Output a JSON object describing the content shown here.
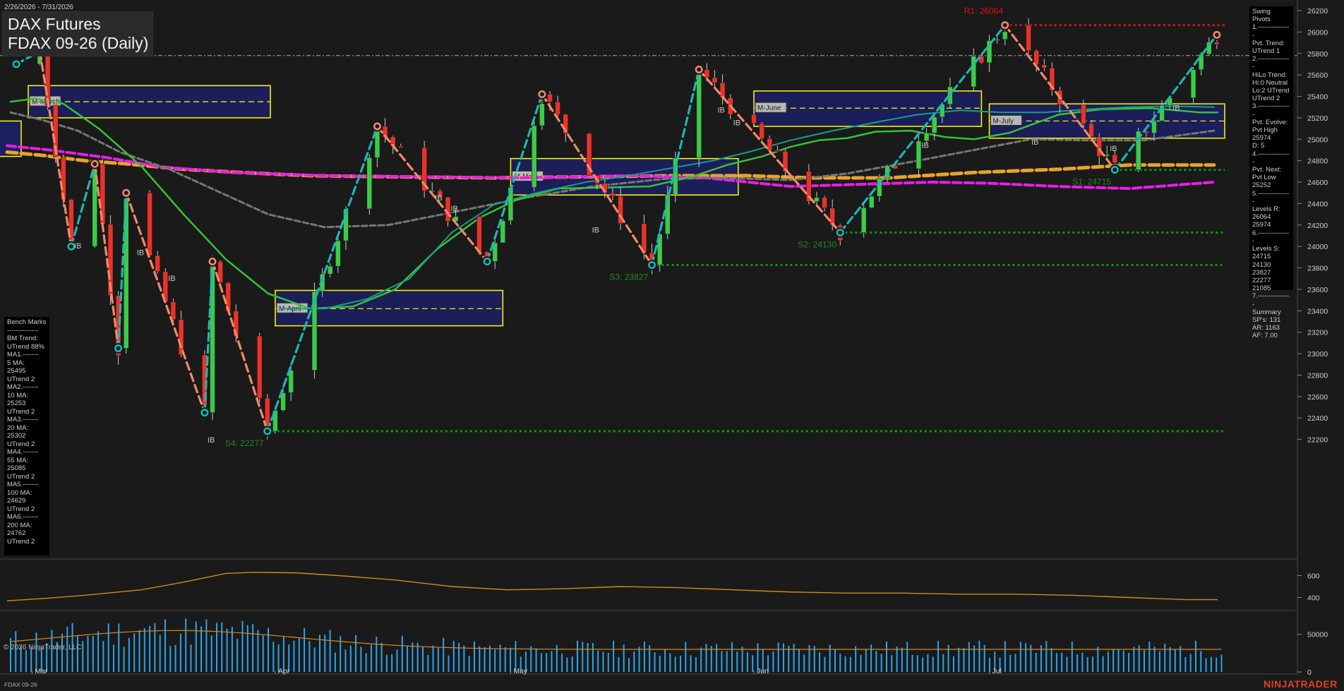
{
  "header": {
    "date_range": "2/26/2026 - 7/31/2026",
    "instrument": "DAX Futures",
    "contract": "FDAX 09-26 (Daily)"
  },
  "pivot_panel": {
    "lines": [
      "Swing Pivots",
      "1.---------------",
      "Pvt. Trend:",
      "UTrend 1",
      "2.---------------",
      "HiLo Trend:",
      "Hi:0 Neutral",
      "Lo:2 UTrend",
      "UTrend 2",
      "3.---------------",
      "Pvt. Evolve:",
      "Pvt High",
      "25974",
      "D: 5",
      "4.---------------",
      "Pvt. Next:",
      "Pvt Low",
      "25252",
      "5.---------------",
      "Levels R:",
      "26064",
      "25974",
      "6.---------------",
      "Levels S:",
      "24715",
      "24130",
      "23827",
      "22277",
      "21085",
      "7.---------------",
      "Summary",
      "SP's: 131",
      "AR: 1163",
      "AF: 7.00"
    ]
  },
  "bench_panel": {
    "lines": [
      "Bench Marks",
      "--------------",
      "BM Trend:",
      "UTrend 88%",
      "MA1.-------",
      "5 MA:",
      "25495",
      "UTrend 2",
      "MA2.-------",
      "10 MA:",
      "25253",
      "UTrend 2",
      "MA3.-------",
      "20 MA:",
      "25302",
      "UTrend 2",
      "MA4.-------",
      "55 MA:",
      "25085",
      "UTrend 2",
      "MA5.-------",
      "100 MA:",
      "24629",
      "UTrend 2",
      "MA6.-------",
      "200 MA:",
      "24762",
      "UTrend 2"
    ]
  },
  "footer": {
    "copyright": "© 2026 NinjaTrader, LLC",
    "symbol": "FDAX 09-26",
    "brand": "NINJATRADER"
  },
  "colors": {
    "background": "#1a1a1a",
    "up_candle": "#3ec94a",
    "down_candle": "#e8332b",
    "swing_up": "#1fb5b5",
    "swing_down": "#f08a6a",
    "resistance": "#e01010",
    "support": "#0a9a0a",
    "ma_green": "#36c136",
    "ma_teal": "#1a9c8f",
    "ma_gray": "#777777",
    "ma_orange": "#e8a32c",
    "ma_magenta": "#e81ee8",
    "monthly_box_fill": "#1c1f60",
    "monthly_box_border": "#ffff00",
    "volume": "#2aa4ee",
    "oscillator": "#d4891a"
  },
  "chart_data": {
    "type": "candlestick",
    "title": "FDAX 09-26 (Daily)",
    "x_range": [
      "2026-02-26",
      "2026-07-31"
    ],
    "x_ticks": [
      "Mar",
      "Apr",
      "May",
      "Jun",
      "Jul"
    ],
    "y_range": [
      22000,
      26200
    ],
    "y_ticks": [
      22200,
      22400,
      22600,
      22800,
      23000,
      23200,
      23400,
      23600,
      23800,
      24000,
      24200,
      24400,
      24600,
      24800,
      25000,
      25200,
      25400,
      25600,
      25800,
      26000,
      26200
    ],
    "swing_points": [
      {
        "date": "2026-02-27",
        "price": 25700,
        "type": "low"
      },
      {
        "date": "2026-03-02",
        "price": 25820,
        "type": "high"
      },
      {
        "date": "2026-03-06",
        "price": 24000,
        "type": "low"
      },
      {
        "date": "2026-03-09",
        "price": 24770,
        "type": "high"
      },
      {
        "date": "2026-03-12",
        "price": 23050,
        "type": "low"
      },
      {
        "date": "2026-03-13",
        "price": 24500,
        "type": "high"
      },
      {
        "date": "2026-03-23",
        "price": 22450,
        "type": "low"
      },
      {
        "date": "2026-03-24",
        "price": 23860,
        "type": "high"
      },
      {
        "date": "2026-03-31",
        "price": 22277,
        "type": "low"
      },
      {
        "date": "2026-04-14",
        "price": 25120,
        "type": "high"
      },
      {
        "date": "2026-04-28",
        "price": 23860,
        "type": "low"
      },
      {
        "date": "2026-05-05",
        "price": 25420,
        "type": "high"
      },
      {
        "date": "2026-05-19",
        "price": 23827,
        "type": "low"
      },
      {
        "date": "2026-05-25",
        "price": 25650,
        "type": "high"
      },
      {
        "date": "2026-06-12",
        "price": 24130,
        "type": "low"
      },
      {
        "date": "2026-07-03",
        "price": 26064,
        "type": "high"
      },
      {
        "date": "2026-07-17",
        "price": 24715,
        "type": "low"
      },
      {
        "date": "2026-07-30",
        "price": 25974,
        "type": "high"
      }
    ],
    "levels": [
      {
        "label": "R1: 26064",
        "price": 26064,
        "type": "resistance"
      },
      {
        "label": "S1: 24715",
        "price": 24715,
        "type": "support"
      },
      {
        "label": "S2: 24130",
        "price": 24130,
        "type": "support"
      },
      {
        "label": "S3: 23827",
        "price": 23827,
        "type": "support"
      },
      {
        "label": "S4: 22277",
        "price": 22277,
        "type": "support"
      }
    ],
    "last_price": 25780,
    "monthly_boxes": [
      {
        "label": "M-March",
        "start": "2026-03-02",
        "end": "2026-04-15",
        "high": 25500,
        "low": 25200,
        "mid": 25350
      },
      {
        "label": "M-April",
        "start": "2026-04-01",
        "end": "2026-04-30",
        "high": 23590,
        "low": 23260,
        "mid": 23420
      },
      {
        "label": "M-May",
        "start": "2026-05-01",
        "end": "2026-05-30",
        "high": 24820,
        "low": 24480,
        "mid": 24650
      },
      {
        "label": "M-June",
        "start": "2026-06-01",
        "end": "2026-06-30",
        "high": 25450,
        "low": 25120,
        "mid": 25290
      },
      {
        "label": "M-July",
        "start": "2026-07-01",
        "end": "2026-07-31",
        "high": 25330,
        "low": 25010,
        "mid": 25170
      }
    ],
    "box_labels": [
      "M-March",
      "M-April",
      "M-May",
      "M-June",
      "M-July"
    ],
    "ib_labels": [
      {
        "text": "IB",
        "date": "2026-03-06",
        "price": 23980
      },
      {
        "text": "IB",
        "date": "2026-03-14",
        "price": 23920
      },
      {
        "text": "IB",
        "date": "2026-03-18",
        "price": 23680
      },
      {
        "text": "IB",
        "date": "2026-03-23",
        "price": 22170
      },
      {
        "text": "IB",
        "date": "2026-04-21",
        "price": 24430
      },
      {
        "text": "IB",
        "date": "2026-04-23",
        "price": 24330
      },
      {
        "text": "IB",
        "date": "2026-05-11",
        "price": 24130
      },
      {
        "text": "IB",
        "date": "2026-05-27",
        "price": 25250
      },
      {
        "text": "IB",
        "date": "2026-05-29",
        "price": 25130
      },
      {
        "text": "IB",
        "date": "2026-06-22",
        "price": 24920
      },
      {
        "text": "IB",
        "date": "2026-07-06",
        "price": 24950
      },
      {
        "text": "IB",
        "date": "2026-07-16",
        "price": 24890
      },
      {
        "text": "IB",
        "date": "2026-07-24",
        "price": 25270
      }
    ],
    "oscillator": {
      "y_ticks": [
        400,
        600
      ],
      "y_range": [
        300,
        700
      ]
    },
    "volume": {
      "y_ticks": [
        0,
        50000
      ],
      "y_range": [
        0,
        75000
      ]
    }
  }
}
